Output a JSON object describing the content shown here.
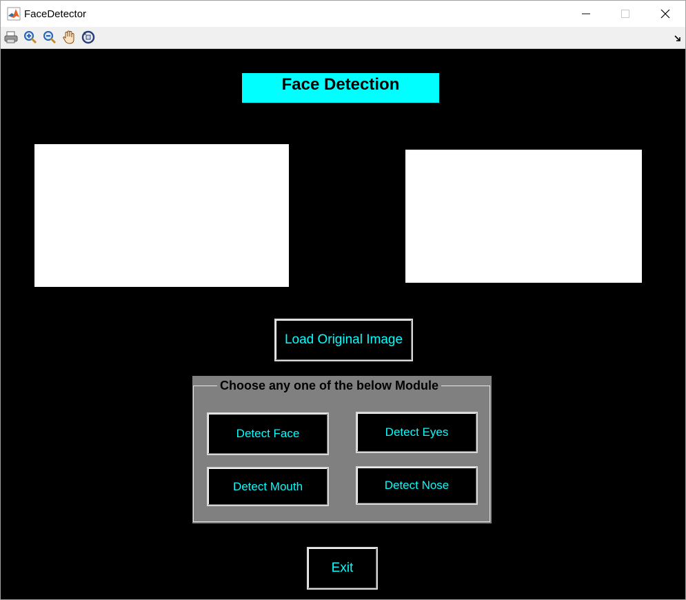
{
  "window": {
    "title": "FaceDetector",
    "controls": [
      "minimize-icon",
      "maximize-icon",
      "close-icon"
    ]
  },
  "toolbar": {
    "tools": [
      "print-icon",
      "zoom-in-icon",
      "zoom-out-icon",
      "pan-hand-icon",
      "rotate-3d-icon"
    ]
  },
  "figure": {
    "title": "Face Detection",
    "load_button": "Load Original Image",
    "module_panel": {
      "title": "Choose any one of the below Module",
      "buttons": {
        "face": "Detect Face",
        "eyes": "Detect Eyes",
        "mouth": "Detect Mouth",
        "nose": "Detect Nose"
      }
    },
    "exit_button": "Exit"
  },
  "colors": {
    "figure_bg": "#000000",
    "title_bg": "#00ffff",
    "button_text": "#00ffff",
    "panel_bg": "#808080"
  }
}
